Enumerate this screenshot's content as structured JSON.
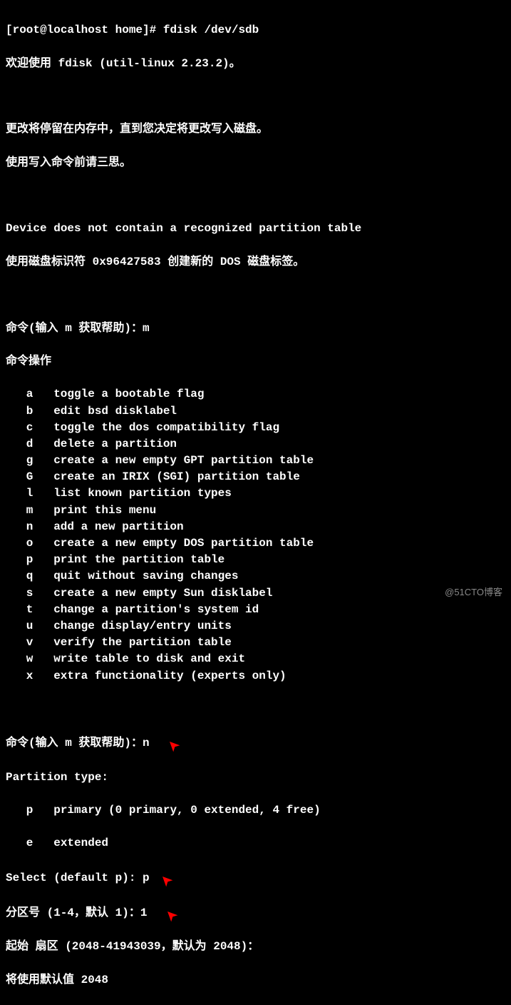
{
  "prompt_line": "[root@localhost home]# fdisk /dev/sdb",
  "welcome": "欢迎使用 fdisk (util-linux 2.23.2)。",
  "warning1": "更改将停留在内存中，直到您决定将更改写入磁盘。",
  "warning2": "使用写入命令前请三思。",
  "device_msg": "Device does not contain a recognized partition table",
  "label_msg": "使用磁盘标识符 0x96427583 创建新的 DOS 磁盘标签。",
  "cmd_prompt1": "命令(输入 m 获取帮助)：m",
  "cmd_ops_header": "命令操作",
  "menu": [
    {
      "k": "a",
      "d": "toggle a bootable flag"
    },
    {
      "k": "b",
      "d": "edit bsd disklabel"
    },
    {
      "k": "c",
      "d": "toggle the dos compatibility flag"
    },
    {
      "k": "d",
      "d": "delete a partition"
    },
    {
      "k": "g",
      "d": "create a new empty GPT partition table"
    },
    {
      "k": "G",
      "d": "create an IRIX (SGI) partition table"
    },
    {
      "k": "l",
      "d": "list known partition types"
    },
    {
      "k": "m",
      "d": "print this menu"
    },
    {
      "k": "n",
      "d": "add a new partition"
    },
    {
      "k": "o",
      "d": "create a new empty DOS partition table"
    },
    {
      "k": "p",
      "d": "print the partition table"
    },
    {
      "k": "q",
      "d": "quit without saving changes"
    },
    {
      "k": "s",
      "d": "create a new empty Sun disklabel"
    },
    {
      "k": "t",
      "d": "change a partition's system id"
    },
    {
      "k": "u",
      "d": "change display/entry units"
    },
    {
      "k": "v",
      "d": "verify the partition table"
    },
    {
      "k": "w",
      "d": "write table to disk and exit"
    },
    {
      "k": "x",
      "d": "extra functionality (experts only)"
    }
  ],
  "cmd_prompt2": "命令(输入 m 获取帮助)：n  ",
  "ptype_header": "Partition type:",
  "ptype_p": "   p   primary (0 primary, 0 extended, 4 free)",
  "ptype_e": "   e   extended",
  "select_line": "Select (default p): p ",
  "partnum_line": "分区号 (1-4，默认 1)：1  ",
  "sector_line": "起始 扇区 (2048-41943039，默认为 2048)：",
  "default_line": "将使用默认值 2048",
  "watermark": "@51CTO博客"
}
